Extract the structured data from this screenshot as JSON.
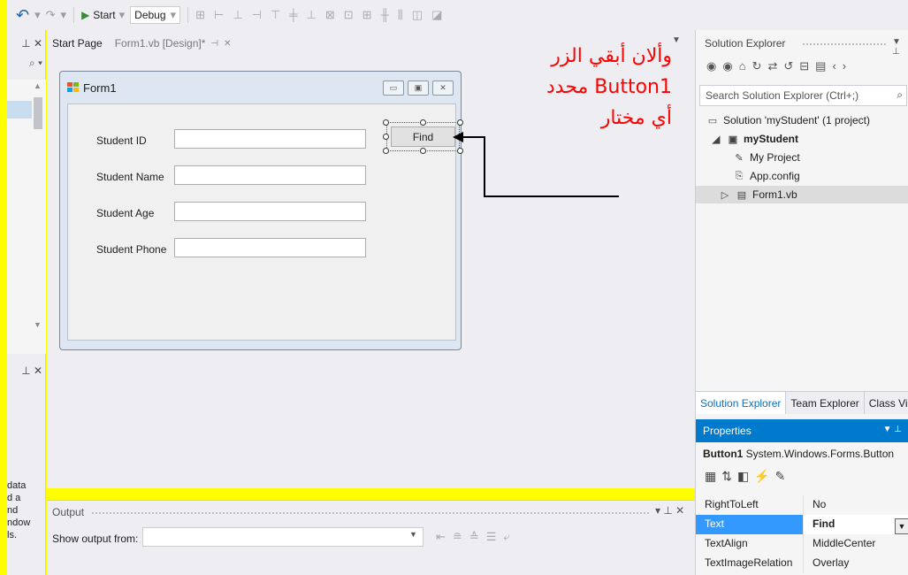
{
  "toolbar": {
    "undo_icon": "undo-icon",
    "start_label": "Start",
    "config_value": "Debug"
  },
  "left_panel": {
    "tail_text": [
      "data",
      "d a",
      "nd",
      "ndow",
      "ls."
    ]
  },
  "tabs": [
    {
      "label": "Start Page"
    },
    {
      "label": "Form1.vb [Design]*"
    }
  ],
  "form": {
    "title": "Form1",
    "fields": [
      {
        "label": "Student ID"
      },
      {
        "label": "Student Name"
      },
      {
        "label": "Student Age"
      },
      {
        "label": "Student Phone"
      }
    ],
    "find_button": "Find"
  },
  "annotation": {
    "line1": "وألان أبقي الزر",
    "line2": "Button1 محدد",
    "line3": "أي مختار",
    "color": "#ff0000"
  },
  "output": {
    "title": "Output",
    "show_from_label": "Show output from:"
  },
  "solution_explorer": {
    "title": "Solution Explorer",
    "search_placeholder": "Search Solution Explorer (Ctrl+;)",
    "tree": [
      {
        "label": "Solution 'myStudent' (1 project)"
      },
      {
        "label": "myStudent"
      },
      {
        "label": "My Project"
      },
      {
        "label": "App.config"
      },
      {
        "label": "Form1.vb"
      }
    ],
    "tabs": [
      "Solution Explorer",
      "Team Explorer",
      "Class View"
    ]
  },
  "properties": {
    "title": "Properties",
    "object_name": "Button1",
    "object_type": "System.Windows.Forms.Button",
    "rows": [
      {
        "name": "RightToLeft",
        "value": "No"
      },
      {
        "name": "Text",
        "value": "Find"
      },
      {
        "name": "TextAlign",
        "value": "MiddleCenter"
      },
      {
        "name": "TextImageRelation",
        "value": "Overlay"
      }
    ]
  },
  "colors": {
    "background_highlight": "#ffff00",
    "accent": "#007acc",
    "selection": "#3399ff"
  }
}
